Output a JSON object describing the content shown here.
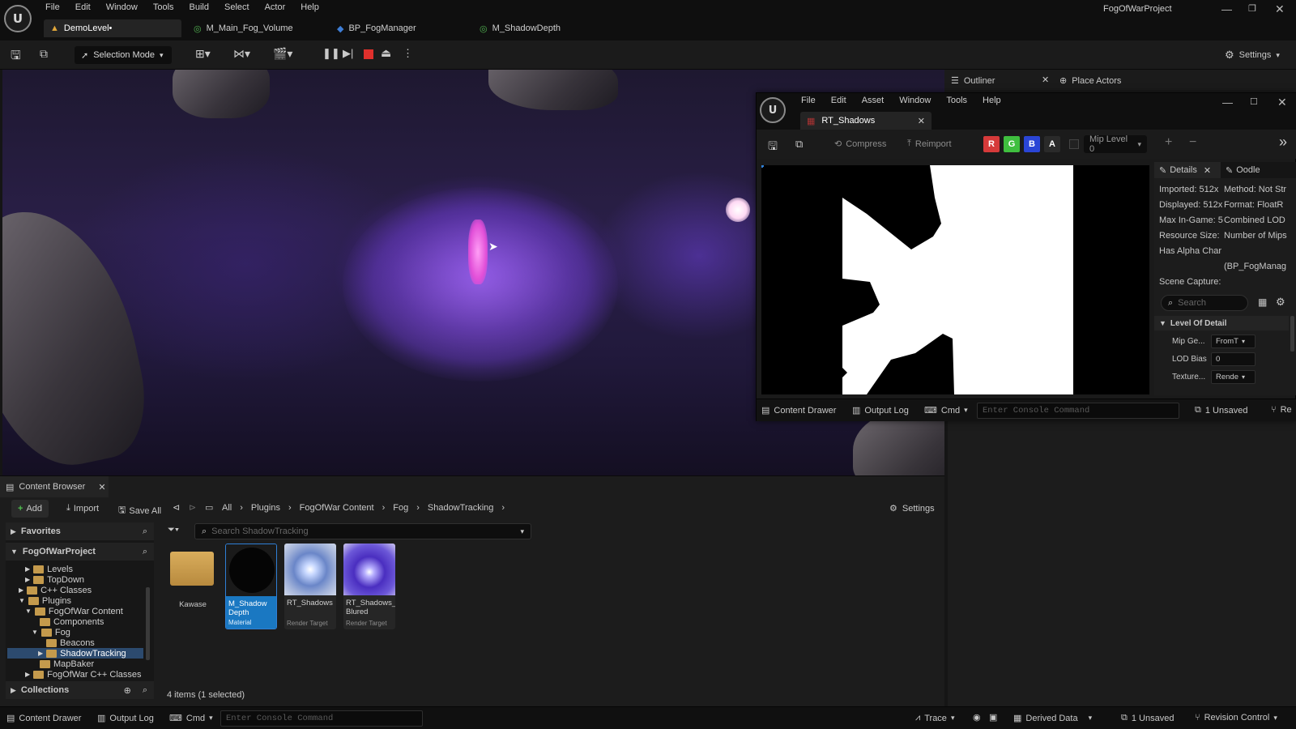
{
  "app": {
    "project_name": "FogOfWarProject",
    "menu": [
      "File",
      "Edit",
      "Window",
      "Tools",
      "Build",
      "Select",
      "Actor",
      "Help"
    ],
    "tabs": [
      {
        "label": "DemoLevel•",
        "icon": "level-icon"
      },
      {
        "label": "M_Main_Fog_Volume",
        "icon": "material-icon"
      },
      {
        "label": "BP_FogManager",
        "icon": "blueprint-icon"
      },
      {
        "label": "M_ShadowDepth",
        "icon": "material-icon"
      }
    ]
  },
  "toolbar": {
    "selection_mode": "Selection Mode",
    "settings": "Settings"
  },
  "panels": {
    "outliner": "Outliner",
    "place_actors": "Place Actors"
  },
  "texture_editor": {
    "menu": [
      "File",
      "Edit",
      "Asset",
      "Window",
      "Tools",
      "Help"
    ],
    "tab_title": "RT_Shadows",
    "compress": "Compress",
    "reimport": "Reimport",
    "channels": [
      "R",
      "G",
      "B",
      "A"
    ],
    "mip_level": "Mip Level 0",
    "details_tab": "Details",
    "oodle_tab": "Oodle",
    "details_left": [
      "Imported: 512x",
      "Displayed: 512x",
      "Max In-Game: 5",
      "Resource Size:",
      "Has Alpha Char"
    ],
    "details_right": [
      "Method: Not Str",
      "Format: FloatR",
      "Combined LOD",
      "Number of Mips",
      ""
    ],
    "bp_ref": "(BP_FogManag",
    "scene_capture": "Scene Capture:",
    "search_placeholder": "Search",
    "lod_section": "Level Of Detail",
    "props": [
      {
        "label": "Mip Ge...",
        "value": "FromT",
        "dropdown": true
      },
      {
        "label": "LOD Bias",
        "value": "0",
        "dropdown": false
      },
      {
        "label": "Texture...",
        "value": "Rende",
        "dropdown": true
      }
    ],
    "bottom": {
      "content_drawer": "Content Drawer",
      "output_log": "Output Log",
      "cmd": "Cmd",
      "console_placeholder": "Enter Console Command",
      "unsaved": "1 Unsaved",
      "revision": "Re"
    }
  },
  "content_browser": {
    "title": "Content Browser",
    "add": "Add",
    "import": "Import",
    "save_all": "Save All",
    "breadcrumb": [
      "All",
      "Plugins",
      "FogOfWar Content",
      "Fog",
      "ShadowTracking"
    ],
    "settings": "Settings",
    "favorites": "Favorites",
    "project_root": "FogOfWarProject",
    "search_placeholder": "Search ShadowTracking",
    "tree": [
      {
        "label": "Levels",
        "indent": 1,
        "expander": true
      },
      {
        "label": "TopDown",
        "indent": 1,
        "expander": true
      },
      {
        "label": "C++ Classes",
        "indent": 0,
        "expander": true
      },
      {
        "label": "Plugins",
        "indent": 0,
        "expander": true,
        "open": true
      },
      {
        "label": "FogOfWar Content",
        "indent": 1,
        "expander": true,
        "open": true
      },
      {
        "label": "Components",
        "indent": 2,
        "expander": false
      },
      {
        "label": "Fog",
        "indent": 2,
        "expander": true,
        "open": true
      },
      {
        "label": "Beacons",
        "indent": 3,
        "expander": false
      },
      {
        "label": "ShadowTracking",
        "indent": 3,
        "expander": true,
        "selected": true
      },
      {
        "label": "MapBaker",
        "indent": 2,
        "expander": false
      },
      {
        "label": "FogOfWar C++ Classes",
        "indent": 1,
        "expander": true
      }
    ],
    "collections": "Collections",
    "assets": [
      {
        "name": "Kawase",
        "type": "",
        "kind": "folder"
      },
      {
        "name": "M_Shadow Depth",
        "type": "Material",
        "kind": "material",
        "selected": true
      },
      {
        "name": "RT_Shadows",
        "type": "Render Target",
        "kind": "rt"
      },
      {
        "name": "RT_Shadows_ Blured",
        "type": "Render Target",
        "kind": "rt-blur"
      }
    ],
    "status": "4 items (1 selected)"
  },
  "statusbar": {
    "content_drawer": "Content Drawer",
    "output_log": "Output Log",
    "cmd": "Cmd",
    "console_placeholder": "Enter Console Command",
    "trace": "Trace",
    "derived_data": "Derived Data",
    "unsaved": "1 Unsaved",
    "revision_control": "Revision Control"
  },
  "colors": {
    "accent_blue": "#2f7fd6",
    "stop_red": "#e0302c",
    "channel_r": "#d63a3a",
    "channel_g": "#3fbf3f",
    "channel_b": "#2a45d6",
    "folder": "#c49a4c",
    "material_badge": "#1a78c2"
  }
}
